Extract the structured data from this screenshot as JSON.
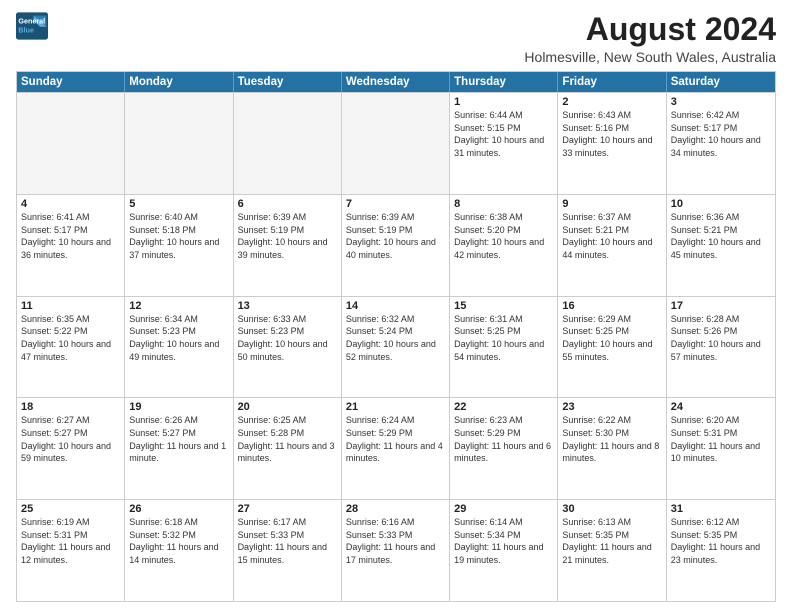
{
  "logo": {
    "line1": "General",
    "line2": "Blue"
  },
  "title": "August 2024",
  "subtitle": "Holmesville, New South Wales, Australia",
  "weekdays": [
    "Sunday",
    "Monday",
    "Tuesday",
    "Wednesday",
    "Thursday",
    "Friday",
    "Saturday"
  ],
  "weeks": [
    [
      {
        "day": "",
        "empty": true
      },
      {
        "day": "",
        "empty": true
      },
      {
        "day": "",
        "empty": true
      },
      {
        "day": "",
        "empty": true
      },
      {
        "day": "1",
        "sunrise": "6:44 AM",
        "sunset": "5:15 PM",
        "daylight": "10 hours and 31 minutes."
      },
      {
        "day": "2",
        "sunrise": "6:43 AM",
        "sunset": "5:16 PM",
        "daylight": "10 hours and 33 minutes."
      },
      {
        "day": "3",
        "sunrise": "6:42 AM",
        "sunset": "5:17 PM",
        "daylight": "10 hours and 34 minutes."
      }
    ],
    [
      {
        "day": "4",
        "sunrise": "6:41 AM",
        "sunset": "5:17 PM",
        "daylight": "10 hours and 36 minutes."
      },
      {
        "day": "5",
        "sunrise": "6:40 AM",
        "sunset": "5:18 PM",
        "daylight": "10 hours and 37 minutes."
      },
      {
        "day": "6",
        "sunrise": "6:39 AM",
        "sunset": "5:19 PM",
        "daylight": "10 hours and 39 minutes."
      },
      {
        "day": "7",
        "sunrise": "6:39 AM",
        "sunset": "5:19 PM",
        "daylight": "10 hours and 40 minutes."
      },
      {
        "day": "8",
        "sunrise": "6:38 AM",
        "sunset": "5:20 PM",
        "daylight": "10 hours and 42 minutes."
      },
      {
        "day": "9",
        "sunrise": "6:37 AM",
        "sunset": "5:21 PM",
        "daylight": "10 hours and 44 minutes."
      },
      {
        "day": "10",
        "sunrise": "6:36 AM",
        "sunset": "5:21 PM",
        "daylight": "10 hours and 45 minutes."
      }
    ],
    [
      {
        "day": "11",
        "sunrise": "6:35 AM",
        "sunset": "5:22 PM",
        "daylight": "10 hours and 47 minutes."
      },
      {
        "day": "12",
        "sunrise": "6:34 AM",
        "sunset": "5:23 PM",
        "daylight": "10 hours and 49 minutes."
      },
      {
        "day": "13",
        "sunrise": "6:33 AM",
        "sunset": "5:23 PM",
        "daylight": "10 hours and 50 minutes."
      },
      {
        "day": "14",
        "sunrise": "6:32 AM",
        "sunset": "5:24 PM",
        "daylight": "10 hours and 52 minutes."
      },
      {
        "day": "15",
        "sunrise": "6:31 AM",
        "sunset": "5:25 PM",
        "daylight": "10 hours and 54 minutes."
      },
      {
        "day": "16",
        "sunrise": "6:29 AM",
        "sunset": "5:25 PM",
        "daylight": "10 hours and 55 minutes."
      },
      {
        "day": "17",
        "sunrise": "6:28 AM",
        "sunset": "5:26 PM",
        "daylight": "10 hours and 57 minutes."
      }
    ],
    [
      {
        "day": "18",
        "sunrise": "6:27 AM",
        "sunset": "5:27 PM",
        "daylight": "10 hours and 59 minutes."
      },
      {
        "day": "19",
        "sunrise": "6:26 AM",
        "sunset": "5:27 PM",
        "daylight": "11 hours and 1 minute."
      },
      {
        "day": "20",
        "sunrise": "6:25 AM",
        "sunset": "5:28 PM",
        "daylight": "11 hours and 3 minutes."
      },
      {
        "day": "21",
        "sunrise": "6:24 AM",
        "sunset": "5:29 PM",
        "daylight": "11 hours and 4 minutes."
      },
      {
        "day": "22",
        "sunrise": "6:23 AM",
        "sunset": "5:29 PM",
        "daylight": "11 hours and 6 minutes."
      },
      {
        "day": "23",
        "sunrise": "6:22 AM",
        "sunset": "5:30 PM",
        "daylight": "11 hours and 8 minutes."
      },
      {
        "day": "24",
        "sunrise": "6:20 AM",
        "sunset": "5:31 PM",
        "daylight": "11 hours and 10 minutes."
      }
    ],
    [
      {
        "day": "25",
        "sunrise": "6:19 AM",
        "sunset": "5:31 PM",
        "daylight": "11 hours and 12 minutes."
      },
      {
        "day": "26",
        "sunrise": "6:18 AM",
        "sunset": "5:32 PM",
        "daylight": "11 hours and 14 minutes."
      },
      {
        "day": "27",
        "sunrise": "6:17 AM",
        "sunset": "5:33 PM",
        "daylight": "11 hours and 15 minutes."
      },
      {
        "day": "28",
        "sunrise": "6:16 AM",
        "sunset": "5:33 PM",
        "daylight": "11 hours and 17 minutes."
      },
      {
        "day": "29",
        "sunrise": "6:14 AM",
        "sunset": "5:34 PM",
        "daylight": "11 hours and 19 minutes."
      },
      {
        "day": "30",
        "sunrise": "6:13 AM",
        "sunset": "5:35 PM",
        "daylight": "11 hours and 21 minutes."
      },
      {
        "day": "31",
        "sunrise": "6:12 AM",
        "sunset": "5:35 PM",
        "daylight": "11 hours and 23 minutes."
      }
    ]
  ]
}
